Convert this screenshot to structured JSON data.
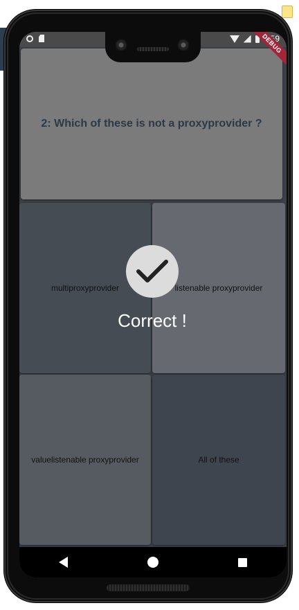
{
  "status_bar": {
    "time": "4:59"
  },
  "debug_banner": {
    "label": "DEBUG"
  },
  "quiz": {
    "question": "2: Which of these is not a proxyprovider ?",
    "options": [
      {
        "label": "multiproxyprovider"
      },
      {
        "label": "listenable proxyprovider"
      },
      {
        "label": "valuelistenable proxyprovider"
      },
      {
        "label": "All of these"
      }
    ]
  },
  "feedback": {
    "message": "Correct !",
    "icon": "checkmark-icon"
  },
  "nav": {
    "icons": [
      "back-icon",
      "home-icon",
      "recents-icon"
    ]
  },
  "colors": {
    "question_bg": "#7b7b7b",
    "question_text": "#2b3a48",
    "debug_ribbon": "#a3253a",
    "check_circle": "#dcdcdc"
  }
}
